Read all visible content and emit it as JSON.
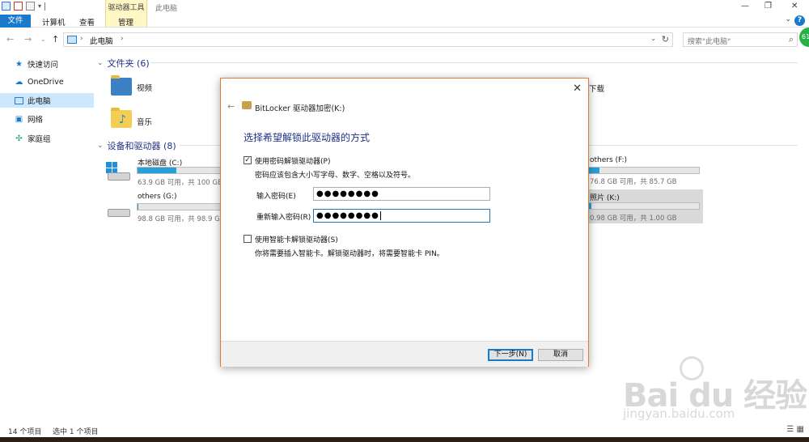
{
  "ribbon": {
    "tool_tab": "驱动器工具",
    "window_title": "此电脑",
    "menu": {
      "file": "文件",
      "computer": "计算机",
      "view": "查看",
      "manage": "管理"
    },
    "help": "?"
  },
  "window_controls": {
    "minimize": "—",
    "maximize": "❐",
    "close": "✕"
  },
  "address": {
    "path": "此电脑",
    "search_placeholder": "搜索\"此电脑\"",
    "badge": "61"
  },
  "sidebar": {
    "items": [
      {
        "label": "快速访问",
        "icon": "star-icon"
      },
      {
        "label": "OneDrive",
        "icon": "cloud-icon"
      },
      {
        "label": "此电脑",
        "icon": "computer-icon",
        "selected": true
      },
      {
        "label": "网络",
        "icon": "network-icon"
      },
      {
        "label": "家庭组",
        "icon": "homegroup-icon"
      }
    ]
  },
  "content": {
    "folders_header": "文件夹 (6)",
    "folders": [
      {
        "label": "视频",
        "icon": "video-folder-icon"
      },
      {
        "label": "音乐",
        "icon": "music-folder-icon"
      },
      {
        "label": "下载",
        "icon": "download-folder-icon"
      }
    ],
    "devices_header": "设备和驱动器 (8)",
    "drives": [
      {
        "name": "本地磁盘 (C:)",
        "info": "63.9 GB 可用，共 100 GB",
        "used_fraction": 0.36
      },
      {
        "name": "others (G:)",
        "info": "98.8 GB 可用，共 98.9 GB",
        "used_fraction": 0.01
      },
      {
        "name": "others (F:)",
        "info": "76.8 GB 可用，共 85.7 GB",
        "used_fraction": 0.1
      },
      {
        "name": "照片 (K:)",
        "info": "0.98 GB 可用，共 1.00 GB",
        "used_fraction": 0.02
      }
    ]
  },
  "status": {
    "item_count": "14 个项目",
    "selected": "选中 1 个项目"
  },
  "dialog": {
    "app_title": "BitLocker 驱动器加密(K:)",
    "heading": "选择希望解锁此驱动器的方式",
    "password_option": {
      "label": "使用密码解锁驱动器(P)",
      "checked": true
    },
    "password_hint": "密码应该包含大小写字母、数字、空格以及符号。",
    "enter_password_label": "输入密码(E)",
    "enter_password_value": "●●●●●●●●",
    "reenter_password_label": "重新输入密码(R)",
    "reenter_password_value": "●●●●●●●●",
    "smartcard_option": {
      "label": "使用智能卡解锁驱动器(S)",
      "checked": false
    },
    "smartcard_hint": "你将需要插入智能卡。解锁驱动器时，将需要智能卡 PIN。",
    "next_button": "下一步(N)",
    "cancel_button": "取消"
  },
  "watermark": {
    "main": "Bai du 经验",
    "sub": "jingyan.baidu.com"
  },
  "colors": {
    "accent": "#1979ca",
    "drive_fill": "#26a0da",
    "dialog_border": "#e07a3a",
    "heading": "#1e3287"
  }
}
